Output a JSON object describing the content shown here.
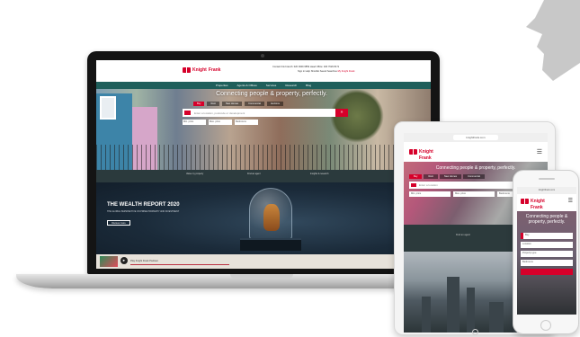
{
  "brand": {
    "logo_line1": "Knight",
    "logo_line2": "Frank",
    "accent": "#d6002a",
    "nav_color": "#1f5f5b"
  },
  "laptop": {
    "top_links_1": "Contact this branch: 020 3909 6859   Head Office: 020 7629 8171",
    "top_links_2": "Sign in   Help   Shortlist   Saved Searches",
    "top_links_accent": "My Knight Frank",
    "nav": [
      "Properties",
      "Agents & Offices",
      "Services",
      "Research",
      "Blog"
    ],
    "hero": {
      "title": "Connecting people & property, perfectly.",
      "tabs": [
        "Buy",
        "Rent",
        "New Homes",
        "Commercial",
        "Auctions"
      ],
      "search_placeholder": "Enter a location, postcode or development",
      "search_button": "»",
      "filters": [
        "Min. price",
        "Max. price",
        "Bedrooms"
      ]
    },
    "strip": [
      "Value my property",
      "Find an agent",
      "Insights & research"
    ],
    "wealth": {
      "title": "THE WEALTH REPORT 2020",
      "subtitle": "THE GLOBAL PERSPECTIVE ON PRIME PROPERTY AND INVESTMENT",
      "button": "Discover more"
    },
    "player": {
      "play_icon": "►",
      "text": "Play Knight Frank Podcast"
    }
  },
  "tablet": {
    "url": "knightfrank.com",
    "menu_icon": "☰",
    "title": "Connecting people & property, perfectly.",
    "tabs": [
      "Buy",
      "Rent",
      "New Homes",
      "Commercial"
    ],
    "search_placeholder": "Enter a location",
    "fields": [
      "Min. price",
      "Max. price",
      "Bedrooms"
    ],
    "mid_text": "Find an agent",
    "city_text": ""
  },
  "phone": {
    "url": "knightfrank.com",
    "menu_icon": "☰",
    "title": "Connecting people & property, perfectly.",
    "selects": [
      "Buy",
      "Location",
      "Property type",
      "Bedrooms"
    ]
  }
}
